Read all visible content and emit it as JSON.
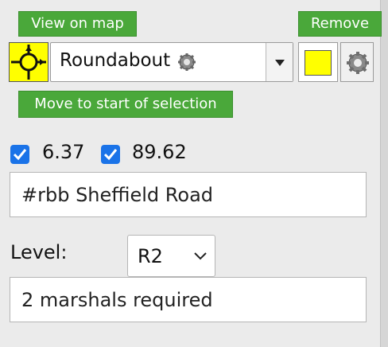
{
  "actions": {
    "view_on_map": "View on map",
    "remove": "Remove",
    "move_to_start": "Move to start of selection"
  },
  "marker": {
    "type_label": "Roundabout",
    "type_icon": "roundabout-icon",
    "color": "#ffff00"
  },
  "checkboxes": [
    {
      "label": "6.37",
      "checked": true
    },
    {
      "label": "89.62",
      "checked": true
    }
  ],
  "description_value": "#rbb Sheffield Road",
  "level": {
    "label": "Level:",
    "selected": "R2"
  },
  "notes_value": "2 marshals required"
}
